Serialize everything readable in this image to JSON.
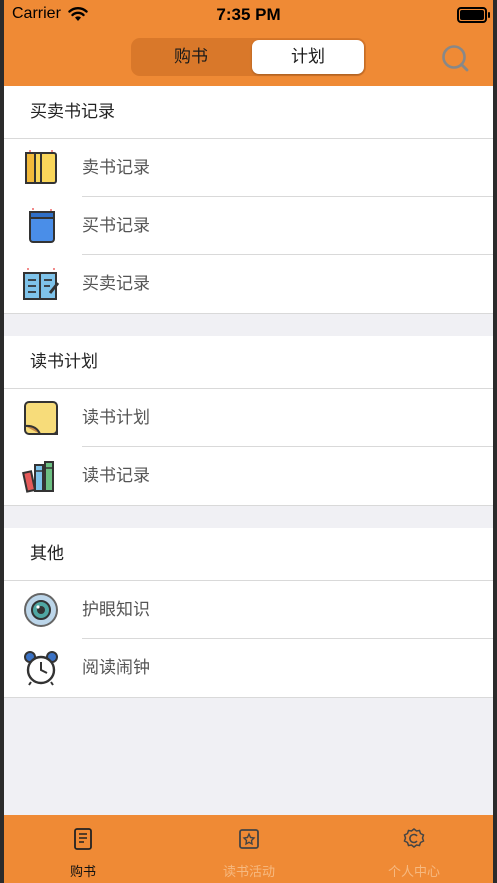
{
  "status_bar": {
    "carrier": "Carrier",
    "time": "7:35 PM"
  },
  "segment": {
    "left_label": "购书",
    "right_label": "计划",
    "selected": "计划"
  },
  "groups": [
    {
      "title": "买卖书记录",
      "items": [
        {
          "label": "卖书记录",
          "icon": "yellow-book-icon"
        },
        {
          "label": "买书记录",
          "icon": "blue-notebook-icon"
        },
        {
          "label": "买卖记录",
          "icon": "open-book-pencil-icon"
        }
      ]
    },
    {
      "title": "读书计划",
      "items": [
        {
          "label": "读书计划",
          "icon": "sticky-note-icon"
        },
        {
          "label": "读书记录",
          "icon": "books-stack-icon"
        }
      ]
    },
    {
      "title": "其他",
      "items": [
        {
          "label": "护眼知识",
          "icon": "eye-icon"
        },
        {
          "label": "阅读闹钟",
          "icon": "alarm-clock-icon"
        }
      ]
    }
  ],
  "tabbar": [
    {
      "label": "购书",
      "icon": "book-tab-icon",
      "active": true
    },
    {
      "label": "读书活动",
      "icon": "activity-tab-icon",
      "active": false
    },
    {
      "label": "个人中心",
      "icon": "profile-tab-icon",
      "active": false
    }
  ],
  "colors": {
    "accent": "#ef8a35",
    "background": "#f0f0f4"
  }
}
